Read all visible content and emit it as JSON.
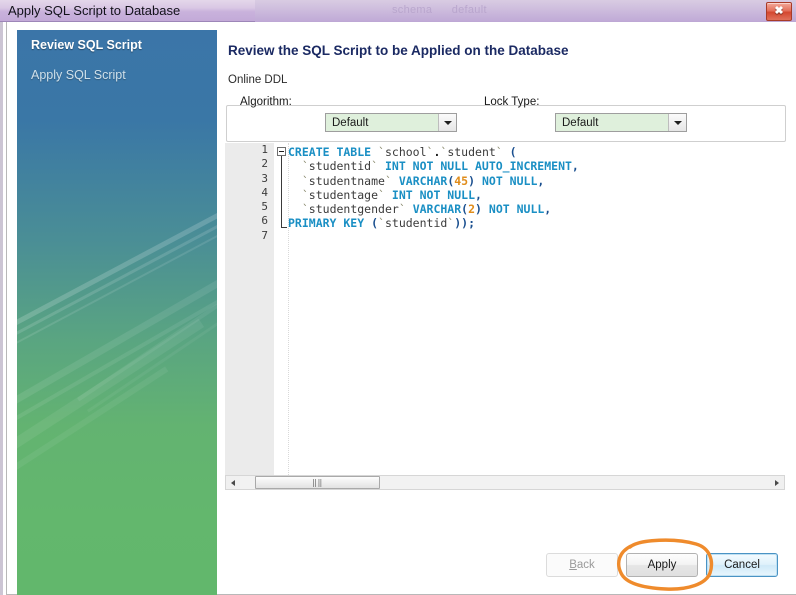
{
  "window": {
    "title": "Apply SQL Script to Database",
    "close_icon": "close-icon",
    "close_glyph": "✖",
    "ghost_labels": [
      "schema",
      "default"
    ]
  },
  "sidebar": {
    "items": [
      {
        "label": "Review SQL Script",
        "state": "active"
      },
      {
        "label": "Apply SQL Script",
        "state": "inactive"
      }
    ]
  },
  "main": {
    "heading": "Review the SQL Script to be Applied on the Database",
    "ddl_group": {
      "legend": "Online DDL",
      "algorithm_label": "Algorithm:",
      "algorithm_value": "Default",
      "lock_label": "Lock Type:",
      "lock_value": "Default",
      "dropdown_icon": "chevron-down-icon"
    },
    "editor": {
      "line_numbers": [
        "1",
        "2",
        "3",
        "4",
        "5",
        "6",
        "7"
      ],
      "fold_marker": "collapse-icon",
      "lines": [
        "CREATE TABLE `school`.`student` (",
        "  `studentid` INT NOT NULL AUTO_INCREMENT,",
        "  `studentname` VARCHAR(45) NOT NULL,",
        "  `studentage` INT NOT NULL,",
        "  `studentgender` VARCHAR(2) NOT NULL,",
        "  PRIMARY KEY (`studentid`));",
        ""
      ]
    },
    "scrollbar": {
      "left_icon": "arrow-left-icon",
      "right_icon": "arrow-right-icon",
      "grip": "‖‖"
    }
  },
  "footer": {
    "back_label": "Back",
    "back_mnemonic": "B",
    "apply_label": "Apply",
    "cancel_label": "Cancel"
  },
  "annotation": {
    "shape": "hand-drawn-ellipse",
    "color": "#ef8b2c",
    "target": "apply-button"
  },
  "colors": {
    "titlebar": "#c9b2dc",
    "sidebar_top": "#3b75a8",
    "sidebar_bottom": "#62b76c",
    "heading": "#1b2a63",
    "combo_bg": "#dff0dc",
    "keyword": "#1a8fc4",
    "number": "#e08c1a",
    "punct": "#1a4f8f",
    "annotation": "#ef8b2c",
    "close_btn": "#d4472f"
  }
}
